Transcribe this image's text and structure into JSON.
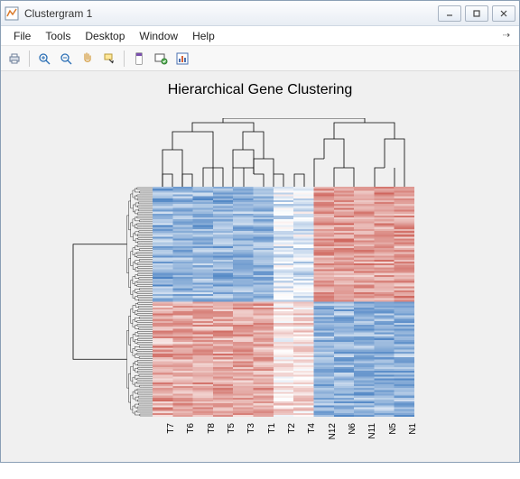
{
  "window": {
    "title": "Clustergram 1"
  },
  "menubar": {
    "items": [
      "File",
      "Tools",
      "Desktop",
      "Window",
      "Help"
    ]
  },
  "chart_data": {
    "type": "heatmap",
    "title": "Hierarchical Gene Clustering",
    "col_labels": [
      "T7",
      "T6",
      "T8",
      "T5",
      "T3",
      "T1",
      "T2",
      "T4",
      "N12",
      "N6",
      "N11",
      "N5",
      "N1"
    ],
    "row_count_approx": 250,
    "colormap": "redblue_diverging",
    "col_cluster_split": 8,
    "row_cluster_split_fraction": 0.5,
    "quadrants": {
      "top_left_T": "low_blue",
      "top_right_N": "high_red",
      "bottom_left_T": "high_red",
      "bottom_right_N": "low_blue"
    }
  }
}
